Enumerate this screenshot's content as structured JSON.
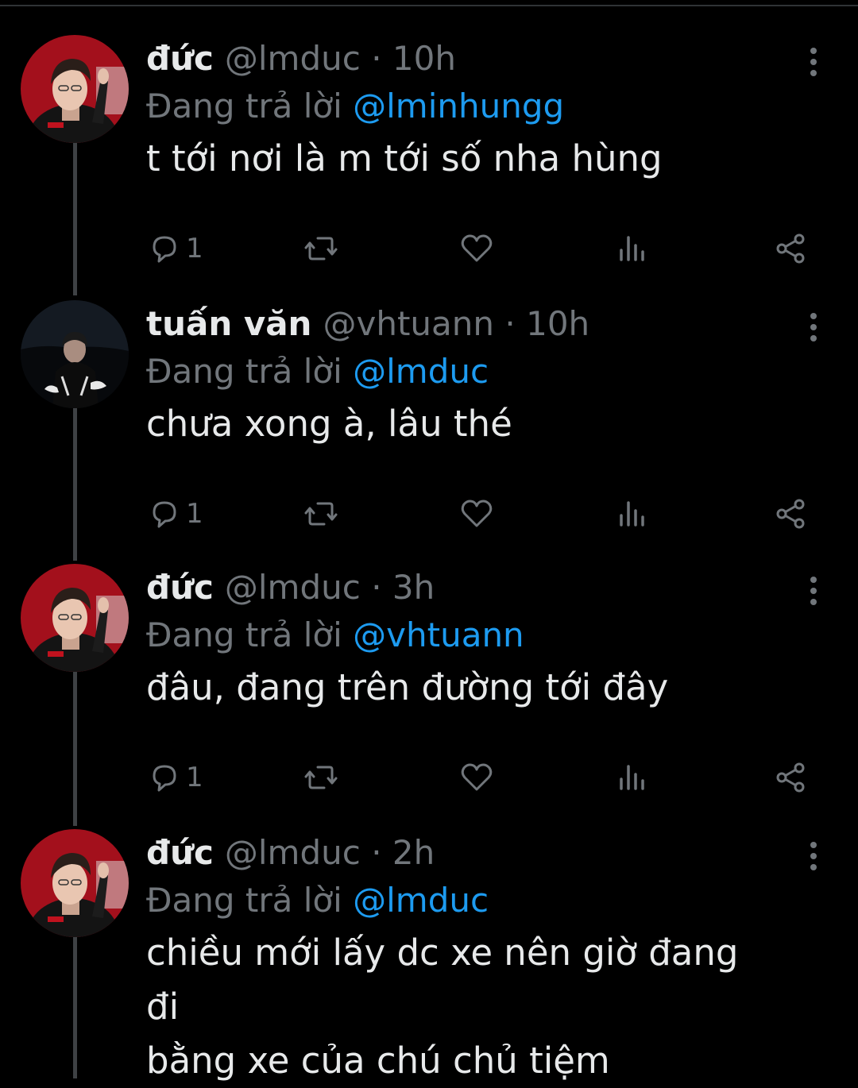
{
  "colors": {
    "background": "#000000",
    "text": "#e7e9ea",
    "muted": "#71767b",
    "mention": "#1d9bf0",
    "thread_line": "#3e4144"
  },
  "tweets": [
    {
      "display_name": "đức",
      "handle": "@lmduc",
      "separator": "·",
      "time": "10h",
      "replying_prefix": "Đang trả lời",
      "replying_to": "@lminhungg",
      "body_lines": [
        "t tới nơi là m tới số nha hùng"
      ],
      "reply_count": "1",
      "avatar_icon": "avatar-duc-icon"
    },
    {
      "display_name": "tuấn văn",
      "handle": "@vhtuann",
      "separator": "·",
      "time": "10h",
      "replying_prefix": "Đang trả lời",
      "replying_to": "@lmduc",
      "body_lines": [
        "chưa xong à, lâu thé"
      ],
      "reply_count": "1",
      "avatar_icon": "avatar-tuan-icon"
    },
    {
      "display_name": "đức",
      "handle": "@lmduc",
      "separator": "·",
      "time": "3h",
      "replying_prefix": "Đang trả lời",
      "replying_to": "@vhtuann",
      "body_lines": [
        "đâu, đang trên đường tới đây"
      ],
      "reply_count": "1",
      "avatar_icon": "avatar-duc-icon"
    },
    {
      "display_name": "đức",
      "handle": "@lmduc",
      "separator": "·",
      "time": "2h",
      "replying_prefix": "Đang trả lời",
      "replying_to": "@lmduc",
      "body_lines": [
        "chiều mới lấy dc xe nên giờ đang đi",
        "bằng xe của chú chủ tiệm"
      ],
      "reply_count": "",
      "avatar_icon": "avatar-duc-icon"
    }
  ],
  "icons": {
    "reply": "reply-icon",
    "retweet": "retweet-icon",
    "like": "heart-icon",
    "views": "views-icon",
    "share": "share-icon",
    "more": "more-options-icon"
  }
}
